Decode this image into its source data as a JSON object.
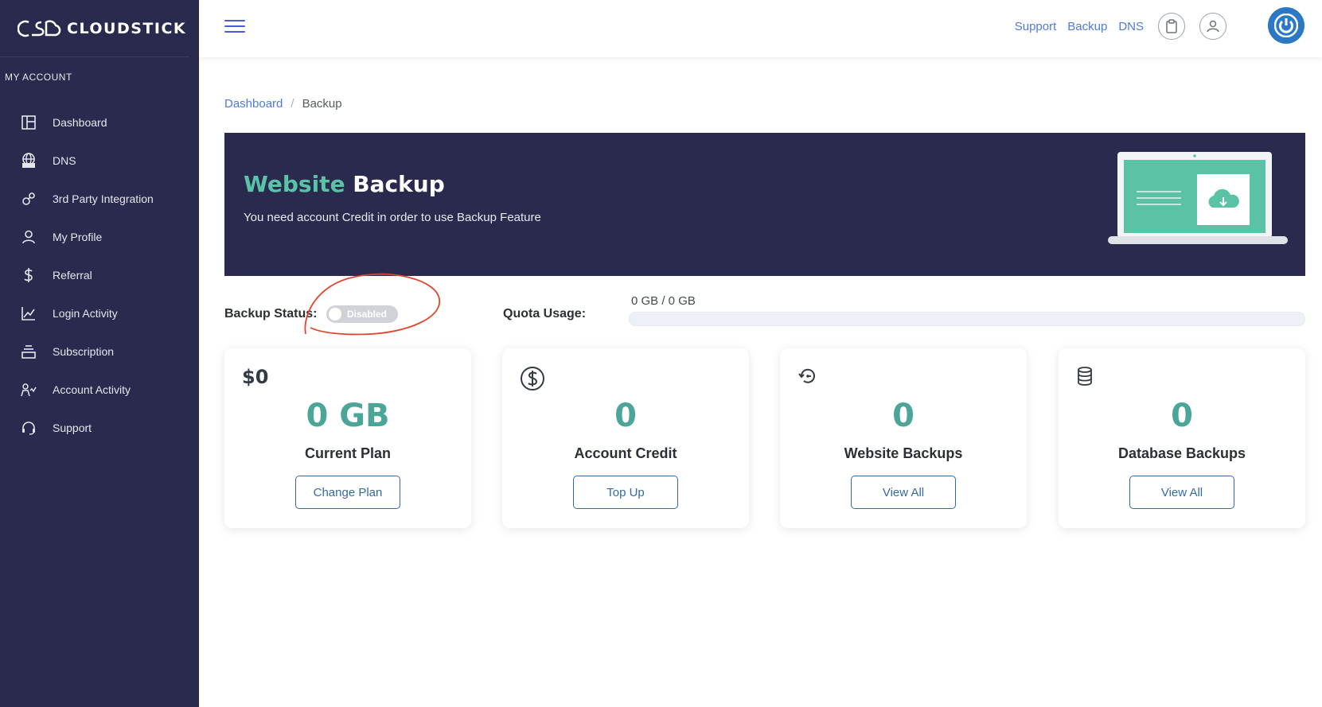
{
  "brand": {
    "name": "CLOUDSTICK"
  },
  "sidebar": {
    "section_label": "MY ACCOUNT",
    "items": [
      {
        "label": "Dashboard",
        "icon": "dashboard-icon"
      },
      {
        "label": "DNS",
        "icon": "dns-icon"
      },
      {
        "label": "3rd Party Integration",
        "icon": "gears-icon"
      },
      {
        "label": "My Profile",
        "icon": "user-icon"
      },
      {
        "label": "Referral",
        "icon": "dollar-icon"
      },
      {
        "label": "Login Activity",
        "icon": "chart-icon"
      },
      {
        "label": "Subscription",
        "icon": "stack-icon"
      },
      {
        "label": "Account Activity",
        "icon": "people-icon"
      },
      {
        "label": "Support",
        "icon": "headset-icon"
      }
    ]
  },
  "topbar": {
    "links": [
      "Support",
      "Backup",
      "DNS"
    ]
  },
  "breadcrumb": {
    "root": "Dashboard",
    "separator": "/",
    "current": "Backup"
  },
  "banner": {
    "title_accent": "Website",
    "title_rest": " Backup",
    "subtitle": "You need account Credit in order to use Backup Feature"
  },
  "status": {
    "backup_label": "Backup Status:",
    "toggle_text": "Disabled",
    "quota_label": "Quota Usage:",
    "quota_text": "0 GB / 0 GB",
    "quota_fraction": 0
  },
  "cards": [
    {
      "icon_text": "$0",
      "value": "0 GB",
      "title": "Current Plan",
      "button": "Change Plan"
    },
    {
      "icon": "dollar-circle-icon",
      "value": "0",
      "title": "Account Credit",
      "button": "Top Up"
    },
    {
      "icon": "history-icon",
      "value": "0",
      "title": "Website Backups",
      "button": "View All"
    },
    {
      "icon": "database-icon",
      "value": "0",
      "title": "Database Backups",
      "button": "View All"
    }
  ],
  "colors": {
    "sidebar": "#2a2a4e",
    "accent": "#5ac3a6",
    "link": "#4e7bd8",
    "annotation": "#e0452e"
  }
}
